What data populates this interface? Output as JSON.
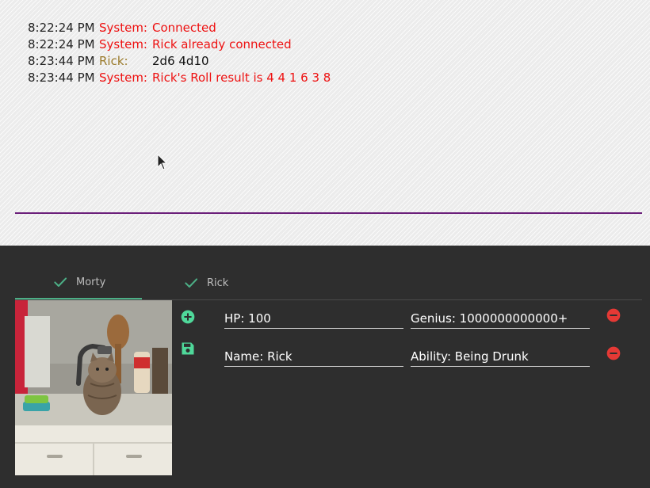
{
  "chat": {
    "lines": [
      {
        "time": "8:22:24 PM",
        "sender": "System:",
        "message": "Connected"
      },
      {
        "time": "8:22:24 PM",
        "sender": "System:",
        "message": "Rick already connected"
      },
      {
        "time": "8:23:44 PM",
        "sender": "Rick:",
        "message": "2d6 4d10"
      },
      {
        "time": "8:23:44 PM",
        "sender": "System:",
        "message": "Rick's Roll result is 4 4 1 6 3 8"
      }
    ]
  },
  "tabs": [
    {
      "label": "Morty",
      "active": true
    },
    {
      "label": "Rick",
      "active": false
    }
  ],
  "character": {
    "photo_icon": "cat-in-sink-photo",
    "actions": [
      {
        "icon": "add-circle-icon",
        "color": "#4fd89a"
      },
      {
        "icon": "save-icon",
        "color": "#4fd89a"
      }
    ],
    "fields": [
      {
        "value": "HP: 100"
      },
      {
        "value": "Genius: 1000000000000+"
      },
      {
        "value": "Name: Rick"
      },
      {
        "value": "Ability: Being Drunk"
      }
    ],
    "remove_icon": "remove-circle-icon",
    "remove_color": "#e53935"
  },
  "colors": {
    "system": "#ee1111",
    "rick": "#9a7a2a",
    "divider": "#6b1f7a",
    "accent": "#4caf86"
  }
}
